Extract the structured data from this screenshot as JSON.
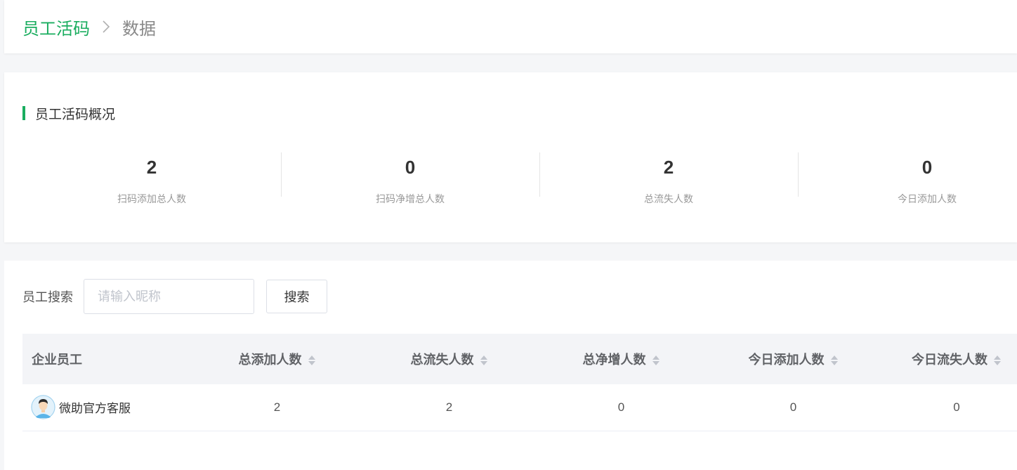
{
  "breadcrumb": {
    "parent": "员工活码",
    "current": "数据"
  },
  "overview": {
    "title": "员工活码概况",
    "stats": [
      {
        "value": "2",
        "label": "扫码添加总人数"
      },
      {
        "value": "0",
        "label": "扫码净增总人数"
      },
      {
        "value": "2",
        "label": "总流失人数"
      },
      {
        "value": "0",
        "label": "今日添加人数"
      }
    ]
  },
  "search": {
    "label": "员工搜索",
    "placeholder": "请输入昵称",
    "value": "",
    "button_label": "搜索"
  },
  "table": {
    "columns": [
      "企业员工",
      "总添加人数",
      "总流失人数",
      "总净增人数",
      "今日添加人数",
      "今日流失人数"
    ],
    "rows": [
      {
        "name": "微助官方客服",
        "total_add": "2",
        "total_lost": "2",
        "net_add": "0",
        "today_add": "0",
        "today_lost": "0"
      }
    ]
  },
  "colors": {
    "accent": "#1aad5f",
    "background": "#f5f6f8",
    "header_bg": "#f3f4f7"
  }
}
